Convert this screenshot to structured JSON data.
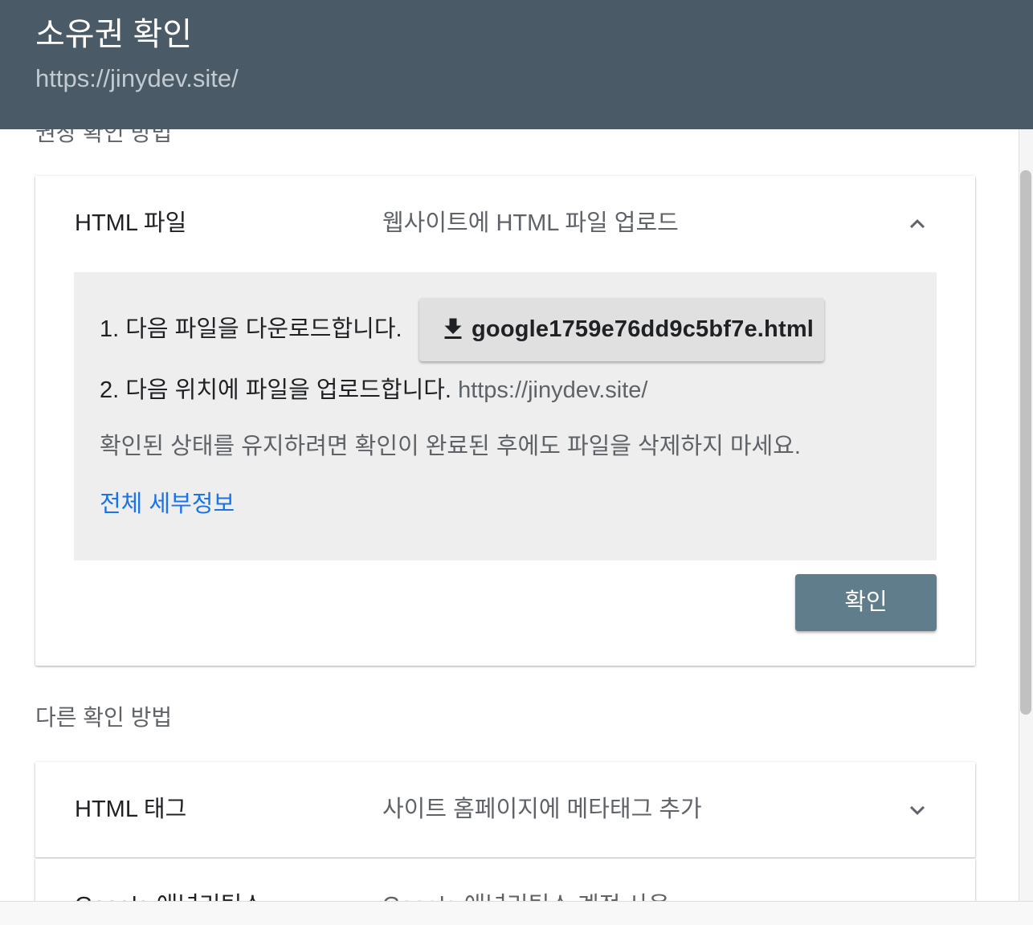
{
  "header": {
    "title": "소유권 확인",
    "url": "https://jinydev.site/"
  },
  "recommended_section": {
    "label": "권장 확인 방법"
  },
  "html_file_card": {
    "name": "HTML 파일",
    "description": "웹사이트에 HTML 파일 업로드",
    "expanded": true,
    "chevron_icon": "chevron-up-icon",
    "step1_text": "1. 다음 파일을 다운로드합니다.",
    "download_icon": "download-icon",
    "download_filename": "google1759e76dd9c5bf7e.html",
    "step2_text": "2. 다음 위치에 파일을 업로드합니다.",
    "step2_url": "https://jinydev.site/",
    "note": "확인된 상태를 유지하려면 확인이 완료된 후에도 파일을 삭제하지 마세요.",
    "details_link": "전체 세부정보",
    "verify_button": "확인"
  },
  "other_section": {
    "label": "다른 확인 방법"
  },
  "other_methods": [
    {
      "name": "HTML 태그",
      "description": "사이트 홈페이지에 메타태그 추가",
      "chevron_icon": "chevron-down-icon"
    },
    {
      "name": "Google 애널리틱스",
      "description": "Google 애널리틱스 계정 사용",
      "chevron_icon": "chevron-down-icon"
    }
  ],
  "colors": {
    "header_bg": "#4a5a66",
    "verify_button_bg": "#607d8b",
    "link": "#1a73e8",
    "panel_bg": "#eeeeee"
  }
}
